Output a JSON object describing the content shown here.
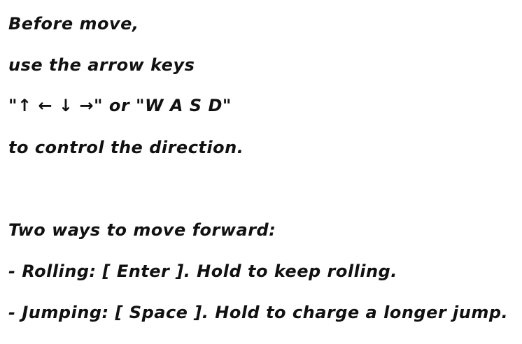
{
  "instructions": {
    "direction": {
      "line1": "Before move,",
      "line2": "use the arrow keys",
      "line3": "\"↑ ← ↓ →\" or \"W A S D\"",
      "line4": "to control the direction."
    },
    "movement": {
      "heading": "Two ways to move forward:",
      "rolling": "- Rolling: [ Enter ]. Hold to keep rolling.",
      "jumping": "- Jumping: [ Space ]. Hold to charge a longer jump."
    }
  }
}
